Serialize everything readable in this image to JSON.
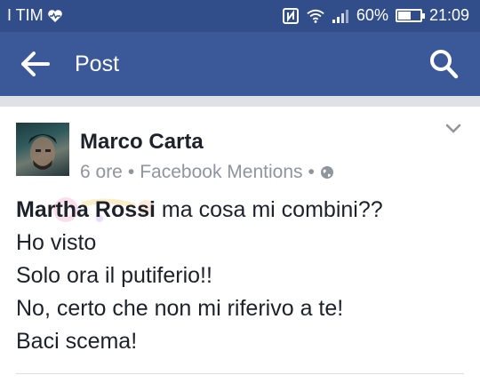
{
  "status_bar": {
    "carrier": "I TIM",
    "battery": "60%",
    "battery_level": 0.6,
    "time": "21:09"
  },
  "app_bar": {
    "title": "Post"
  },
  "post": {
    "author": "Marco Carta",
    "time_ago": "6 ore",
    "source": "Facebook Mentions",
    "separator": "•",
    "mention": "Martha Rossi",
    "lines": [
      " ma cosa mi combini??",
      "Ho visto",
      "Solo ora il putiferio!!",
      "No, certo che non mi riferivo a te!",
      "Baci scema!"
    ]
  },
  "colors": {
    "status_bar": "#324e8a",
    "app_bar": "#3b5998",
    "text": "#1d2129",
    "meta": "#90949c"
  }
}
